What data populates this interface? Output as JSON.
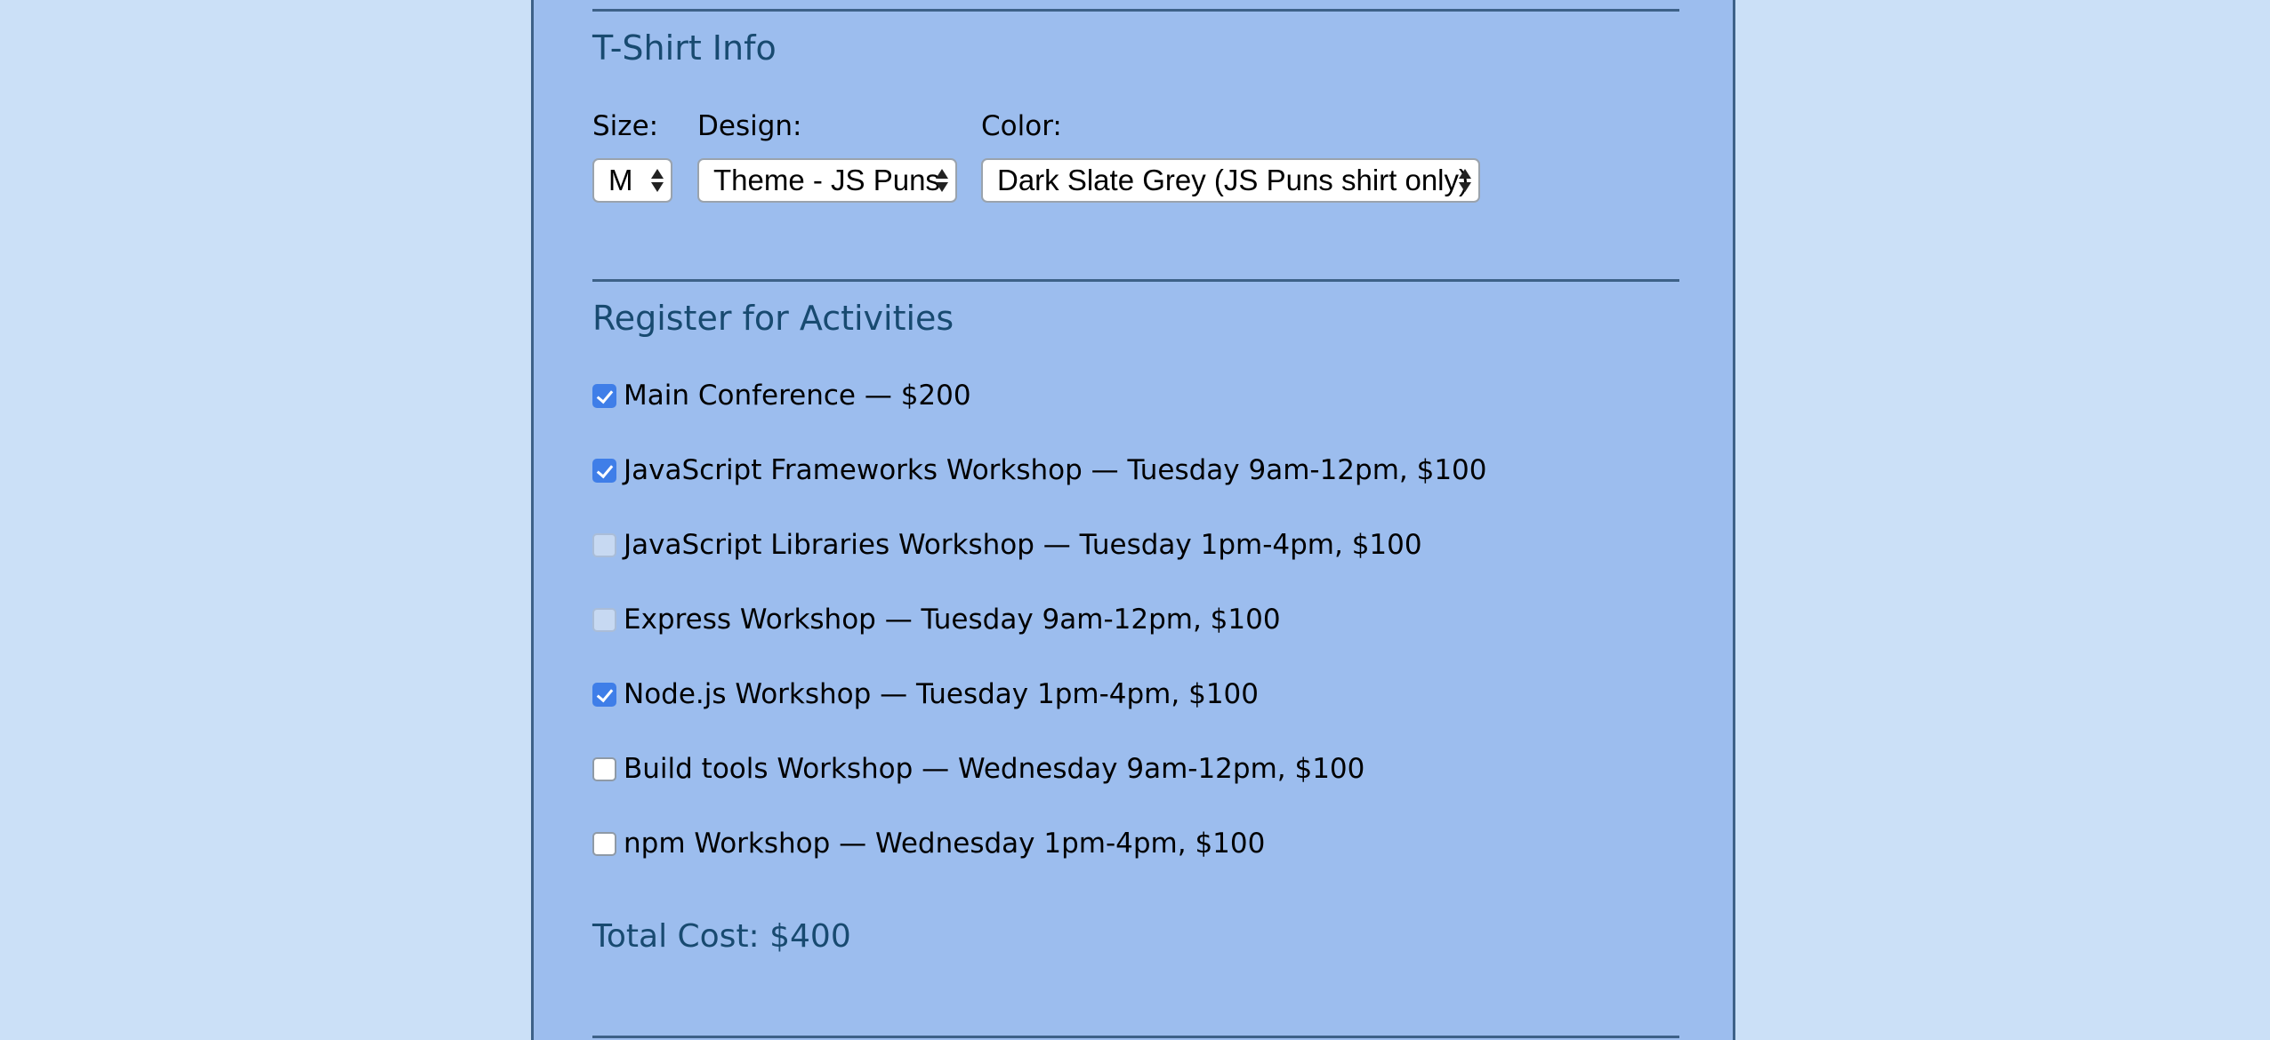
{
  "tshirt": {
    "title": "T-Shirt Info",
    "size_label": "Size:",
    "size_value": "M",
    "design_label": "Design:",
    "design_value": "Theme - JS Puns",
    "color_label": "Color:",
    "color_value": "Dark Slate Grey (JS Puns shirt only)"
  },
  "activities": {
    "title": "Register for Activities",
    "items": [
      {
        "label": "Main Conference — $200",
        "state": "checked"
      },
      {
        "label": "JavaScript Frameworks Workshop — Tuesday 9am-12pm, $100",
        "state": "checked"
      },
      {
        "label": "JavaScript Libraries Workshop — Tuesday 1pm-4pm, $100",
        "state": "disabled"
      },
      {
        "label": "Express Workshop — Tuesday 9am-12pm, $100",
        "state": "disabled"
      },
      {
        "label": "Node.js Workshop — Tuesday 1pm-4pm, $100",
        "state": "checked"
      },
      {
        "label": "Build tools Workshop — Wednesday 9am-12pm, $100",
        "state": "unchecked"
      },
      {
        "label": "npm Workshop — Wednesday 1pm-4pm, $100",
        "state": "unchecked"
      }
    ],
    "total": "Total Cost: $400"
  },
  "colors": {
    "page_background": "#cbe0f7",
    "panel_background": "#9cbdee",
    "heading": "#184a70",
    "rule": "#3d6188",
    "checkbox_checked": "#3f7ee8"
  }
}
